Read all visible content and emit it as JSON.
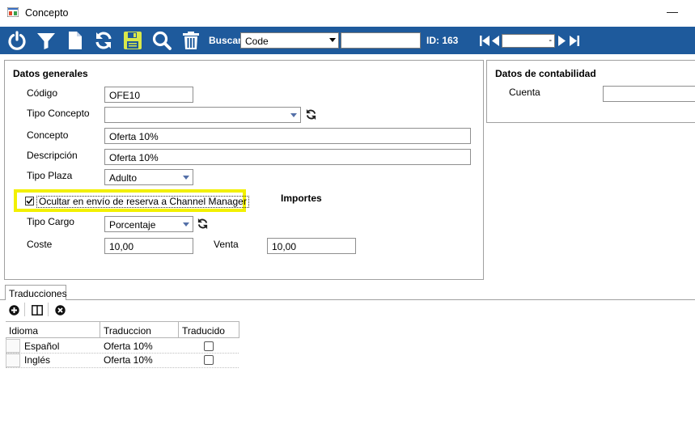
{
  "window": {
    "title": "Concepto",
    "minimize_glyph": "—"
  },
  "toolbar": {
    "icons": [
      "power-icon",
      "filter-icon",
      "new-document-icon",
      "refresh-icon",
      "save-icon",
      "search-icon",
      "delete-icon"
    ],
    "buscar_label": "Buscar",
    "search_field": "Code",
    "search_text": "",
    "id_label": "ID: 163",
    "nav_value": "-"
  },
  "datos_generales": {
    "header": "Datos generales",
    "codigo_label": "Código",
    "codigo_value": "OFE10",
    "tipo_concepto_label": "Tipo Concepto",
    "tipo_concepto_value": "",
    "concepto_label": "Concepto",
    "concepto_value": "Oferta 10%",
    "descripcion_label": "Descripción",
    "descripcion_value": "Oferta 10%",
    "tipo_plaza_label": "Tipo Plaza",
    "tipo_plaza_value": "Adulto",
    "ocultar_label": "Ocultar en envío de reserva a Channel Manager",
    "ocultar_checked": true,
    "importes_header": "Importes",
    "tipo_cargo_label": "Tipo Cargo",
    "tipo_cargo_value": "Porcentaje",
    "coste_label": "Coste",
    "coste_value": "10,00",
    "venta_label": "Venta",
    "venta_value": "10,00"
  },
  "contabilidad": {
    "header": "Datos de contabilidad",
    "cuenta_label": "Cuenta",
    "cuenta_value": ""
  },
  "traducciones": {
    "tab_label": "Traducciones",
    "columns": [
      "Idioma",
      "Traduccion",
      "Traducido"
    ],
    "rows": [
      {
        "idioma": "Español",
        "traduccion": "Oferta 10%",
        "traducido": false
      },
      {
        "idioma": "Inglés",
        "traduccion": "Oferta 10%",
        "traducido": false
      }
    ]
  },
  "colors": {
    "toolbar_bg": "#1e5a9c",
    "highlight": "#f2f000",
    "save_icon": "#d9e84a"
  }
}
